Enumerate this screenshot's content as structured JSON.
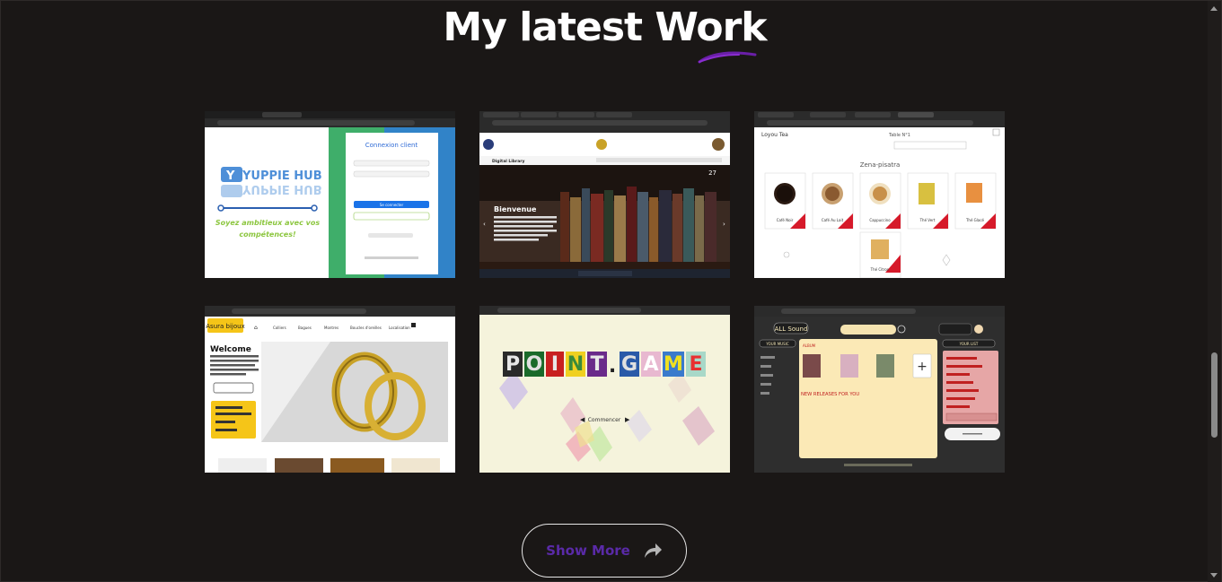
{
  "section": {
    "title": "My latest Work",
    "accent_color": "#6a1fa8"
  },
  "projects": [
    {
      "name": "Yuppie Hub",
      "logo_text": "YUPPIE HUB",
      "tagline": "Soyez ambitieux avec vos compétences!",
      "login_title": "Connexion client",
      "login_button": "Se connecter"
    },
    {
      "name": "Digital Library",
      "brand": "Digital Library",
      "hero_title": "Bienvenue",
      "counter": "27"
    },
    {
      "name": "Zena-pisatra",
      "brand": "Zena-pisatra",
      "products": [
        "Café Noir",
        "Café Au Lait",
        "Cappuccino",
        "Thé Vert",
        "Thé Glacé",
        "Thé Citron"
      ]
    },
    {
      "name": "Asura bijoux",
      "brand": "Asura bijoux",
      "heading": "Welcome",
      "nav": [
        "Colliers",
        "Bagues",
        "Montres",
        "Boucles d'oreilles",
        "Localisation"
      ]
    },
    {
      "name": "POINT.GAME",
      "logo_text": "POINT.GAME",
      "start_label": "Commencer"
    },
    {
      "name": "ALL Sound",
      "brand": "ALL Sound",
      "left_tab": "YOUR MUSIC",
      "right_tab": "YOUR LIST",
      "banner": "NEW RELEASES FOR YOU"
    }
  ],
  "show_more": {
    "label": "Show More",
    "icon": "share-arrow-icon"
  }
}
